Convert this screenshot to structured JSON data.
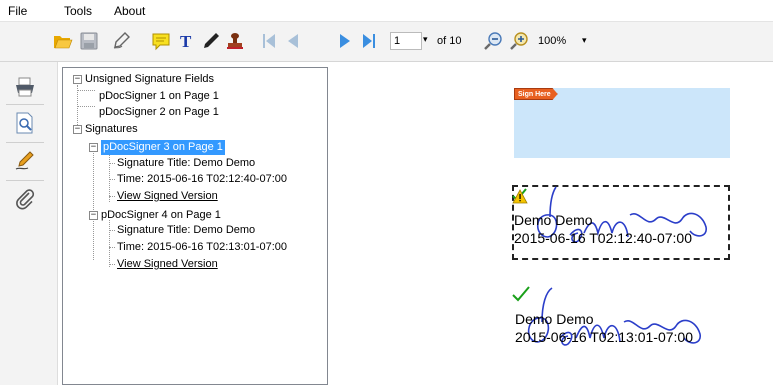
{
  "menu": {
    "file": "File",
    "tools": "Tools",
    "about": "About"
  },
  "toolbar": {
    "page_number": "1",
    "page_of": "of 10",
    "zoom": "100%"
  },
  "tree": {
    "unsigned_root": "Unsigned Signature Fields",
    "unsigned_items": [
      "pDocSigner 1 on Page 1",
      "pDocSigner 2 on Page 1"
    ],
    "signatures_root": "Signatures",
    "signatures": [
      {
        "label": "pDocSigner 3 on Page 1",
        "title": "Signature Title: Demo Demo",
        "time": "Time: 2015-06-16 T02:12:40-07:00",
        "link": "View Signed Version"
      },
      {
        "label": "pDocSigner 4 on Page 1",
        "title": "Signature Title: Demo Demo",
        "time": "Time: 2015-06-16 T02:13:01-07:00",
        "link": "View Signed Version"
      }
    ]
  },
  "document": {
    "sign_here": "Sign Here",
    "sig1_name": "Demo Demo",
    "sig1_date": "2015-06-16 T02:12:40-07:00",
    "sig2_name": "Demo Demo",
    "sig2_date": "2015-06-16 T02:13:01-07:00"
  },
  "colors": {
    "selection": "#3399ff",
    "sig_field": "#cce6fa",
    "ink": "#2b3ec9",
    "check": "#1aa01a",
    "warning": "#f5c400"
  }
}
